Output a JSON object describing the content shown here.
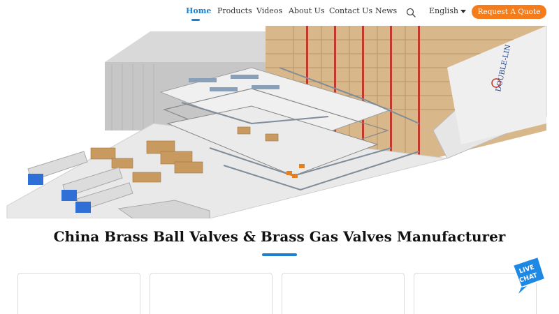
{
  "nav": {
    "items": [
      "Home",
      "Products",
      "Videos",
      "About Us",
      "Contact Us",
      "News"
    ],
    "active": "Home",
    "language": "English",
    "quote_button": "Request A Quote",
    "search_icon": "search-icon"
  },
  "hero": {
    "brand_sign": "DOUBLE-LIN",
    "slides_count": 5,
    "active_slide": 1
  },
  "main": {
    "heading": "China Brass Ball Valves & Brass Gas Valves Manufacturer"
  },
  "chat": {
    "line1": "LIVE",
    "line2": "CHAT",
    "icon": "live-chat-icon"
  },
  "colors": {
    "accent": "#1f7fd1",
    "button": "#f57c1a",
    "chat": "#1e88e5"
  }
}
